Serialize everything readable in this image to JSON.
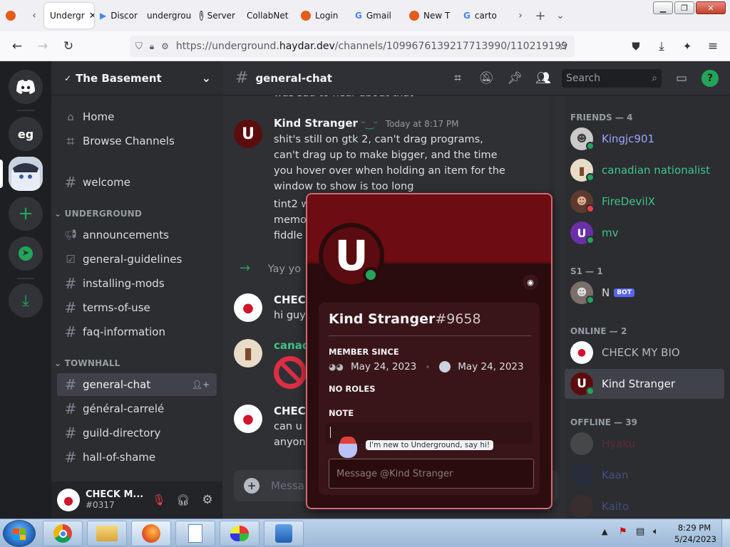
{
  "browser": {
    "tabs": [
      {
        "label": "",
        "icon": "firefox-icon",
        "color": "#e55b1b"
      },
      {
        "label": "Undergr",
        "active": true
      },
      {
        "label": "Discor",
        "icon": "play-icon",
        "color": "#4285f4"
      },
      {
        "label": "undergrou",
        "icon": "",
        "color": ""
      },
      {
        "label": "Server",
        "icon": "info-icon",
        "color": "#333333"
      },
      {
        "label": "CollabNet",
        "icon": "",
        "color": ""
      },
      {
        "label": "Login",
        "icon": "firefox-icon",
        "color": "#e55b1b"
      },
      {
        "label": "Gmail",
        "icon": "google-icon",
        "color": "#4285f4"
      },
      {
        "label": "New T",
        "icon": "firefox-icon",
        "color": "#e55b1b"
      },
      {
        "label": "carto",
        "icon": "google-icon",
        "color": "#4285f4"
      }
    ],
    "url_prefix": "https://underground.",
    "url_host": "haydar.dev",
    "url_path": "/channels/1099676139217713990/110219199"
  },
  "server": {
    "name": "The Basement",
    "home_label": "Home",
    "browse_label": "Browse Channels",
    "welcome": "welcome",
    "categories": [
      {
        "name": "UNDERGROUND",
        "channels": [
          "announcements",
          "general-guidelines",
          "installing-mods",
          "terms-of-use",
          "faq-information"
        ]
      },
      {
        "name": "TOWNHALL",
        "channels": [
          "general-chat",
          "général-carrelé",
          "guild-directory",
          "hall-of-shame"
        ]
      }
    ],
    "guild_eg": "eg"
  },
  "user": {
    "name": "CHECK M...",
    "tag": "#0317"
  },
  "channel": {
    "name": "general-chat",
    "search_placeholder": "Search",
    "composer_placeholder": "Messa"
  },
  "messages": {
    "cut_top": "was sad to hear about that",
    "m1_author": "Kind Stranger",
    "m1_time": "Today at 8:17 PM",
    "m1_text": "shit's still on gtk 2, can't drag programs, can't drag up to make bigger, and the time you hover over when holding an item for the window to show is too long",
    "m2_line1": "tint2 w",
    "m2_line2": "memo",
    "m2_line3": "fiddle v",
    "join_text": "Yay yo",
    "m3_author": "CHECK",
    "m3_text": "hi guys",
    "m4_author": "canadi",
    "m5_author": "CHECK",
    "m5_line1": "can u u",
    "m5_line2": "anyone"
  },
  "members": {
    "friends_header": "FRIENDS — 4",
    "friends": [
      {
        "name": "Kingjc901",
        "color": "#9ea4ff"
      },
      {
        "name": "canadian nationalist",
        "color": "#3ec48a"
      },
      {
        "name": "FireDevilX",
        "color": "#3ec48a"
      },
      {
        "name": "mv",
        "color": "#3ec48a"
      }
    ],
    "s1_header": "S1 — 1",
    "s1": [
      {
        "name": "N",
        "badge": "BOT"
      }
    ],
    "online_header": "ONLINE — 2",
    "online": [
      {
        "name": "CHECK MY BIO"
      },
      {
        "name": "Kind Stranger"
      }
    ],
    "offline_header": "OFFLINE — 39",
    "offline": [
      {
        "name": "Hyaku"
      },
      {
        "name": "Kaan"
      },
      {
        "name": "Kaito"
      }
    ]
  },
  "profile": {
    "name": "Kind Stranger",
    "discriminator": "#9658",
    "member_since_label": "MEMBER SINCE",
    "discord_date": "May 24, 2023",
    "server_date": "May 24, 2023",
    "roles_label": "NO ROLES",
    "note_label": "NOTE",
    "tooltip": "I'm new to Underground, say hi!",
    "message_placeholder": "Message @Kind Stranger"
  },
  "taskbar": {
    "time": "8:29 PM",
    "date": "5/24/2023"
  },
  "colors": {
    "accent": "#23a559",
    "popup_border": "#d26b73",
    "blurple": "#5865f2"
  }
}
